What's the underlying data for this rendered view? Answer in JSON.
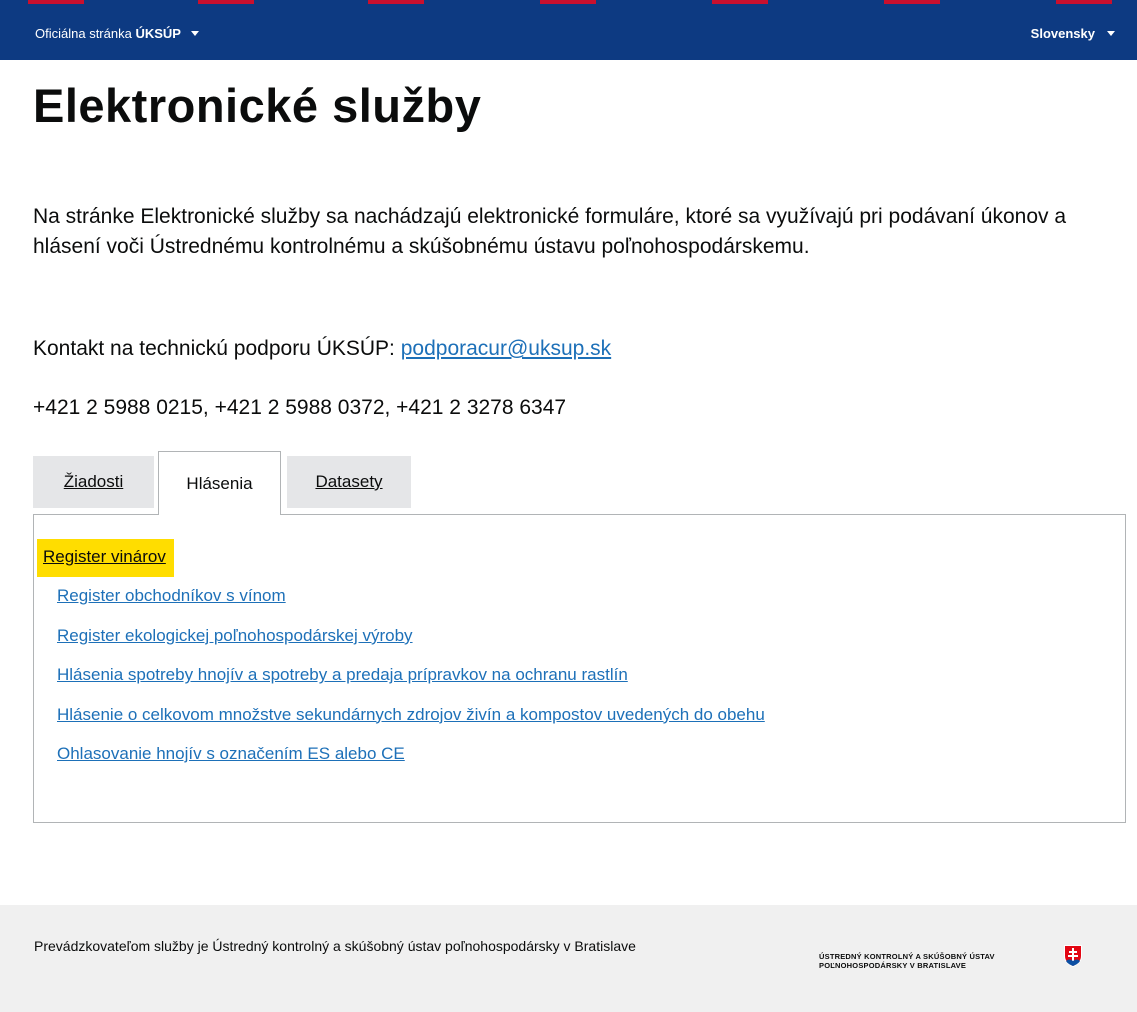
{
  "colors": {
    "topbar": "#0d3a82",
    "stripe_red": "#c8102e",
    "link": "#1d70b8",
    "highlight": "#ffdd00",
    "tab_inactive": "#e5e6e8",
    "footer": "#f0f0f0"
  },
  "header": {
    "official_prefix": "Oficiálna stránka",
    "official_org": "ÚKSÚP",
    "language": "Slovensky"
  },
  "main": {
    "title": "Elektronické služby",
    "intro": "Na stránke Elektronické služby sa nachádzajú elektronické formuláre, ktoré sa využívajú pri podávaní úkonov a hlásení voči Ústrednému kontrolnému a skúšobnému ústavu poľnohospodárskemu.",
    "contact_label": "Kontakt na technickú podporu ÚKSÚP:",
    "contact_email": "podporacur@uksup.sk",
    "phones": "+421 2 5988 0215, +421 2 5988 0372, +421 2 3278 6347"
  },
  "tabs": [
    {
      "label": "Žiadosti",
      "active": false
    },
    {
      "label": "Hlásenia",
      "active": true
    },
    {
      "label": "Datasety",
      "active": false
    }
  ],
  "panel": {
    "links": [
      "Register vinárov",
      "Register obchodníkov s vínom",
      "Register ekologickej poľnohospodárskej výroby",
      "Hlásenia spotreby hnojív a spotreby a predaja prípravkov na ochranu rastlín",
      "Hlásenie o celkovom množstve sekundárnych zdrojov živín a kompostov uvedených do obehu",
      "Ohlasovanie hnojív s označením ES alebo CE"
    ]
  },
  "footer": {
    "operator_text": "Prevádzkovateľom služby je Ústredný kontrolný a skúšobný ústav poľnohospodársky v Bratislave",
    "org_line1": "ÚSTREDNÝ KONTROLNÝ A SKÚŠOBNÝ ÚSTAV",
    "org_line2": "POĽNOHOSPODÁRSKY V BRATISLAVE",
    "crest_icon": "slovak-coat-of-arms-icon"
  }
}
